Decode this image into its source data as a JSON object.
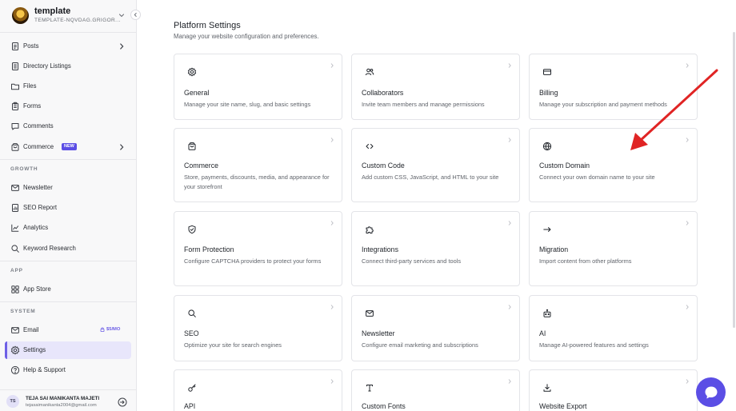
{
  "site": {
    "name": "template",
    "subdomain": "TEMPLATE-NQVDAG.GRIGOR..."
  },
  "sidebar": {
    "main_items": [
      {
        "label": "Posts",
        "icon": "document-icon",
        "has_arrow": true
      },
      {
        "label": "Directory Listings",
        "icon": "list-document-icon"
      },
      {
        "label": "Files",
        "icon": "folder-icon"
      },
      {
        "label": "Forms",
        "icon": "clipboard-icon"
      },
      {
        "label": "Comments",
        "icon": "comment-icon"
      },
      {
        "label": "Commerce",
        "icon": "bag-icon",
        "badge": "NEW",
        "has_arrow": true
      }
    ],
    "sections": [
      {
        "label": "GROWTH",
        "items": [
          {
            "label": "Newsletter",
            "icon": "mail-icon"
          },
          {
            "label": "SEO Report",
            "icon": "report-icon"
          },
          {
            "label": "Analytics",
            "icon": "analytics-icon"
          },
          {
            "label": "Keyword Research",
            "icon": "search-icon"
          }
        ]
      },
      {
        "label": "APP",
        "items": [
          {
            "label": "App Store",
            "icon": "grid-icon"
          }
        ]
      },
      {
        "label": "SYSTEM",
        "items": [
          {
            "label": "Email",
            "icon": "mail-icon",
            "badge": "$5/MO"
          },
          {
            "label": "Settings",
            "icon": "gear-icon",
            "active": true
          },
          {
            "label": "Help & Support",
            "icon": "help-icon"
          }
        ]
      }
    ]
  },
  "user": {
    "initials": "TS",
    "name": "TEJA SAI MANIKANTA MAJETI",
    "email": "tejasaimanikanta2004@gmail.com"
  },
  "main": {
    "title": "Platform Settings",
    "subtitle": "Manage your website configuration and preferences.",
    "cards": [
      {
        "title": "General",
        "description": "Manage your site name, slug, and basic settings",
        "icon": "gear-icon"
      },
      {
        "title": "Collaborators",
        "description": "Invite team members and manage permissions",
        "icon": "users-icon"
      },
      {
        "title": "Billing",
        "description": "Manage your subscription and payment methods",
        "icon": "credit-card-icon"
      },
      {
        "title": "Commerce",
        "description": "Store, payments, discounts, media, and appearance for your storefront",
        "icon": "bag-icon"
      },
      {
        "title": "Custom Code",
        "description": "Add custom CSS, JavaScript, and HTML to your site",
        "icon": "code-icon"
      },
      {
        "title": "Custom Domain",
        "description": "Connect your own domain name to your site",
        "icon": "globe-icon"
      },
      {
        "title": "Form Protection",
        "description": "Configure CAPTCHA providers to protect your forms",
        "icon": "shield-check-icon"
      },
      {
        "title": "Integrations",
        "description": "Connect third-party services and tools",
        "icon": "puzzle-icon"
      },
      {
        "title": "Migration",
        "description": "Import content from other platforms",
        "icon": "arrow-right-icon"
      },
      {
        "title": "SEO",
        "description": "Optimize your site for search engines",
        "icon": "search-icon"
      },
      {
        "title": "Newsletter",
        "description": "Configure email marketing and subscriptions",
        "icon": "mail-icon"
      },
      {
        "title": "AI",
        "description": "Manage AI-powered features and settings",
        "icon": "robot-icon"
      },
      {
        "title": "API",
        "description": "",
        "icon": "key-icon"
      },
      {
        "title": "Custom Fonts",
        "description": "",
        "icon": "type-icon"
      },
      {
        "title": "Website Export",
        "description": "",
        "icon": "download-icon"
      }
    ]
  },
  "colors": {
    "accent": "#5b4ee5",
    "active_bg": "#e8e6fb",
    "annotation": "#e02424"
  }
}
